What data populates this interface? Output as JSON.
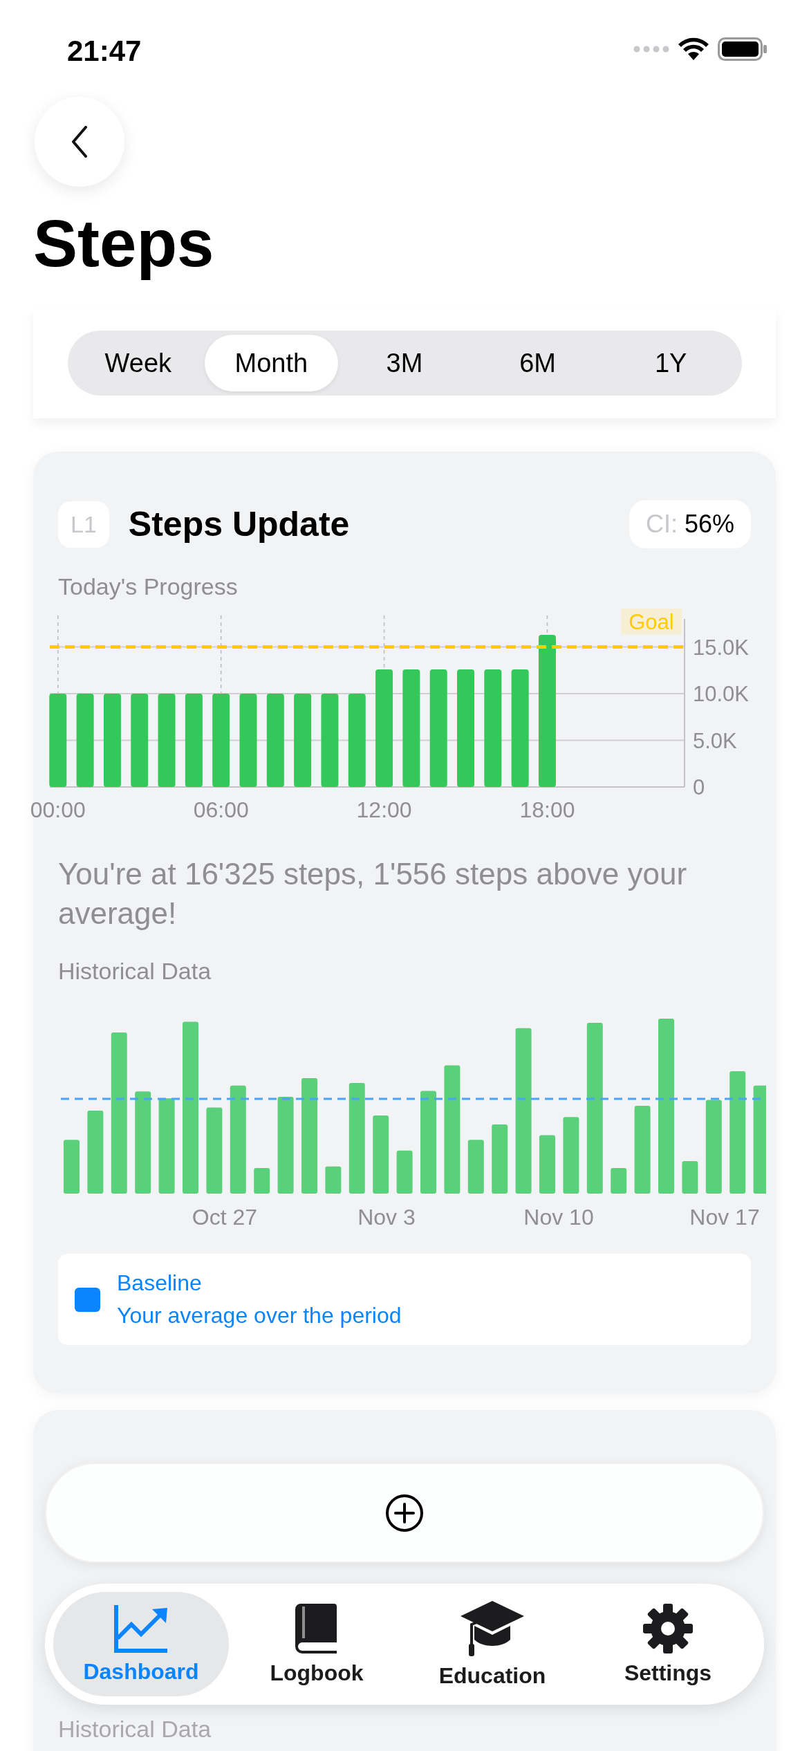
{
  "status_bar": {
    "time": "21:47"
  },
  "title": "Steps",
  "range_tabs": [
    {
      "label": "Week",
      "selected": false
    },
    {
      "label": "Month",
      "selected": true
    },
    {
      "label": "3M",
      "selected": false
    },
    {
      "label": "6M",
      "selected": false
    },
    {
      "label": "1Y",
      "selected": false
    }
  ],
  "card": {
    "badge": "L1",
    "title": "Steps Update",
    "ci_label": "CI:",
    "ci_value": "56%",
    "progress_label": "Today's Progress",
    "chart_data": {
      "type": "bar",
      "x": [
        0,
        1,
        2,
        3,
        4,
        5,
        6,
        7,
        8,
        9,
        10,
        11,
        12,
        13,
        14,
        15,
        16,
        17,
        18
      ],
      "values": [
        10000,
        10000,
        10000,
        10000,
        10000,
        10000,
        10000,
        10000,
        10000,
        10000,
        10000,
        10000,
        12600,
        12600,
        12600,
        12600,
        12600,
        12600,
        16300
      ],
      "xlim": [
        -0.3,
        23.05
      ],
      "ylim": [
        0,
        18000
      ],
      "grid": true,
      "xticks": [
        {
          "value": 0,
          "label": "00:00"
        },
        {
          "value": 6,
          "label": "06:00"
        },
        {
          "value": 12,
          "label": "12:00"
        },
        {
          "value": 18,
          "label": "18:00"
        }
      ],
      "yticks": [
        {
          "value": 0,
          "label": "0"
        },
        {
          "value": 5000,
          "label": "5.0K"
        },
        {
          "value": 10000,
          "label": "10.0K"
        },
        {
          "value": 15000,
          "label": "15.0K"
        }
      ],
      "ref_lines": [
        {
          "value": 15000,
          "label": "Goal",
          "color": "#ffcc00",
          "axis": "y"
        }
      ]
    },
    "summary": "You're at 16'325 steps, 1'556 steps above your average!",
    "history_label": "Historical Data",
    "history_ticks": [
      "Oct 27",
      "Nov 3",
      "Nov 10",
      "Nov 17"
    ],
    "legend": {
      "title": "Baseline",
      "description": "Your average over the period"
    }
  },
  "next_card": {
    "history_label": "Historical Data"
  },
  "tabs": [
    {
      "label": "Dashboard",
      "selected": true
    },
    {
      "label": "Logbook",
      "selected": false
    },
    {
      "label": "Education",
      "selected": false
    },
    {
      "label": "Settings",
      "selected": false
    }
  ]
}
